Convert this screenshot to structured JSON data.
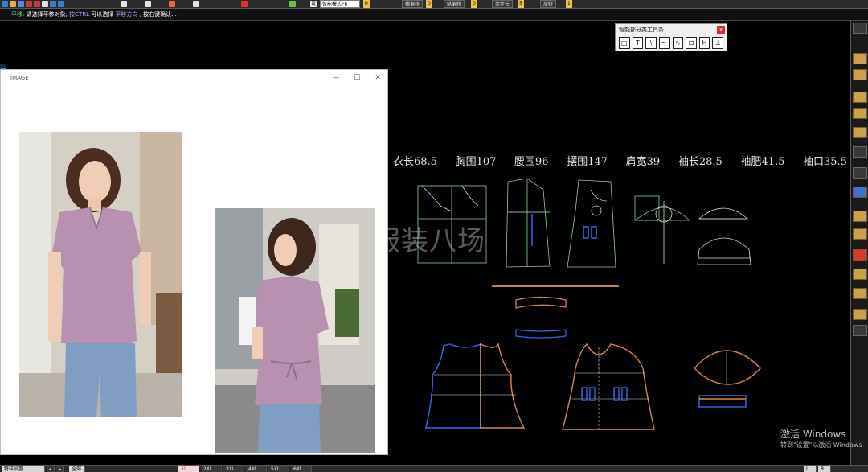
{
  "toolbar": {
    "fields": [
      {
        "label": "",
        "value": "0"
      },
      {
        "label": "横偏移",
        "value": "0"
      },
      {
        "label": "纵偏移",
        "value": "0"
      },
      {
        "label": "单步长",
        "value": "5"
      },
      {
        "label": "旋转",
        "value": "1"
      }
    ],
    "mode_select": "智能模式F6",
    "icon_names": [
      "new-icon",
      "open-icon",
      "save-icon",
      "zoom-in-icon",
      "zoom-out-icon",
      "pan-icon",
      "undo-icon",
      "redo-icon",
      "rotate-icon",
      "move-icon",
      "measure-icon",
      "ruler-icon",
      "layer-icon",
      "color-icon",
      "settings-icon"
    ],
    "settings_label": "设"
  },
  "hint": {
    "lead": "平移:",
    "text1": "请选择平移对象,",
    "accent1": "按CTRL",
    "text2": "可以选择",
    "accent2": "平移方向",
    "text3": ", 按右键确认..."
  },
  "tool_window": {
    "title": "智能部分类工具条",
    "close_label": "x",
    "tools": [
      "□",
      "T",
      "\\",
      "〜",
      "∿",
      "⊟",
      "H",
      "⊥"
    ]
  },
  "measurements": [
    "衣长68.5",
    "胸围107",
    "腰围96",
    "摆围147",
    "肩宽39",
    "袖长28.5",
    "袖肥41.5",
    "袖口35.5"
  ],
  "watermark": "服装八场",
  "image_window": {
    "title": "IMAGE",
    "buttons": [
      "—",
      "☐",
      "✕"
    ]
  },
  "activate": {
    "title": "激活 Windows",
    "subtitle": "转到\"设置\"以激活 Windows"
  },
  "statusbar": {
    "left_tab": "特样设置",
    "all_label": "全部",
    "size_tabs": [
      "XL",
      "2XL",
      "3XL",
      "4XL",
      "5XL",
      "6XL"
    ],
    "right_l": "L",
    "right_r": "R"
  },
  "colors": {
    "pattern_line": "#8fd18f",
    "pattern_blue": "#2f6df0",
    "pattern_orange": "#d98a3a",
    "grid_brown": "#c08050",
    "blouse": "#b692b0",
    "jeans": "#7f9ec2"
  }
}
